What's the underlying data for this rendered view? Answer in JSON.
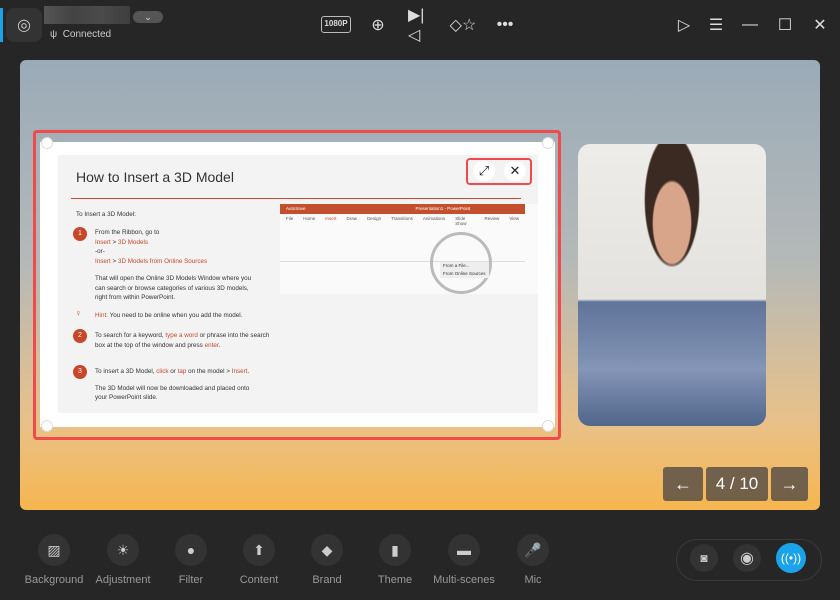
{
  "header": {
    "status": "Connected",
    "dropdown_icon": "chevron-down-icon",
    "resolution": "1080P"
  },
  "slide": {
    "title": "How to Insert a 3D Model",
    "intro": "To Insert a 3D Model:",
    "step1_text": "From the Ribbon, go to",
    "step1_path1a": "Insert",
    "step1_path1b": " > ",
    "step1_path1c": "3D Models",
    "step1_or": "-or-",
    "step1_path2a": "Insert",
    "step1_path2b": " > ",
    "step1_path2c": "3D Models from Online Sources",
    "step1_desc": "That will open the Online 3D Models Window where you can search or browse categories of various 3D models, right from within PowerPoint.",
    "hint_label": "Hint:",
    "hint_text": " You need to be online when you add the model.",
    "step2_a": "To search for a keyword, ",
    "step2_b": "type a word",
    "step2_c": " or phrase into the search box at the top of the window and press ",
    "step2_d": "enter",
    "step3_a": "To insert a 3D Model, ",
    "step3_b": "click",
    "step3_c": " or ",
    "step3_d": "tap",
    "step3_e": " on the model > ",
    "step3_f": "Insert",
    "step3_desc": "The 3D Model will now be downloaded and placed onto your PowerPoint slide.",
    "numbers": [
      "1",
      "2",
      "3"
    ],
    "ppt": {
      "title": "Presentation1 - PowerPoint",
      "autosave": "AutoSave",
      "tabs": [
        "File",
        "Home",
        "Insert",
        "Draw",
        "Design",
        "Transitions",
        "Animations",
        "Slide Show",
        "Review",
        "View"
      ],
      "menu": [
        "From a File...",
        "From Online Sources"
      ]
    }
  },
  "nav": {
    "prev": "←",
    "page": "4 / 10",
    "next": "→"
  },
  "toolbar": [
    {
      "label": "Background",
      "icon": "▨"
    },
    {
      "label": "Adjustment",
      "icon": "☀"
    },
    {
      "label": "Filter",
      "icon": "●"
    },
    {
      "label": "Content",
      "icon": "⬆"
    },
    {
      "label": "Brand",
      "icon": "◆"
    },
    {
      "label": "Theme",
      "icon": "▮"
    },
    {
      "label": "Multi-scenes",
      "icon": "▬"
    },
    {
      "label": "Mic",
      "icon": "🎤"
    }
  ],
  "colors": {
    "accent": "#1aa3e8",
    "highlight": "#f04a4a",
    "slide_accent": "#c8472a"
  }
}
